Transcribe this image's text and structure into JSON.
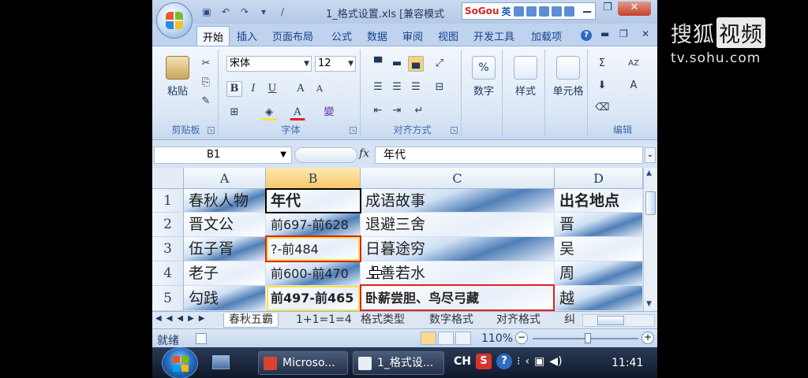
{
  "app": {
    "title": "1_格式设置.xls  [兼容模式",
    "sogou_brand": "SoGou",
    "sogou_mode": "英"
  },
  "ribbon_tabs": [
    "开始",
    "插入",
    "页面布局",
    "公式",
    "数据",
    "审阅",
    "视图",
    "开发工具",
    "加载项"
  ],
  "clipboard": {
    "paste_label": "粘贴",
    "group_label": "剪贴板"
  },
  "font": {
    "family": "宋体",
    "size": "12",
    "bold": "B",
    "italic": "I",
    "underline": "U",
    "grow": "A",
    "shrink": "A",
    "font_color": "A",
    "phonetic": "變",
    "group_label": "字体"
  },
  "alignment": {
    "group_label": "对齐方式"
  },
  "number": {
    "symbol": "%",
    "label": "数字"
  },
  "styles": {
    "label": "样式"
  },
  "cells": {
    "label": "单元格"
  },
  "editing": {
    "sum": "Σ",
    "sort": "AZ",
    "find": "A",
    "group_label": "编辑"
  },
  "formula_bar": {
    "name_box": "B1",
    "fx": "fx",
    "content": "年代"
  },
  "columns": [
    "A",
    "B",
    "C",
    "D"
  ],
  "rows": [
    {
      "num": "1",
      "a": "春秋人物",
      "b": "年代",
      "c": "成语故事",
      "d": "出名地点"
    },
    {
      "num": "2",
      "a": "晋文公",
      "b": "前697-前628",
      "c": "退避三舍",
      "d": "晋"
    },
    {
      "num": "3",
      "a": "伍子胥",
      "b": "?-前484",
      "c": "日暮途穷",
      "d": "吴"
    },
    {
      "num": "4",
      "a": "老子",
      "b": "前600-前470",
      "c": "上善若水",
      "d": "周"
    },
    {
      "num": "5",
      "a": "勾践",
      "b": "前497-前465",
      "c": "卧薪尝胆、鸟尽弓藏",
      "d": "越"
    }
  ],
  "sheet_tabs": [
    "春秋五霸",
    "1+1=1=4",
    "格式类型",
    "数字格式",
    "对齐格式",
    "纠"
  ],
  "status": {
    "ready": "就绪",
    "zoom": "110%"
  },
  "taskbar": {
    "apps": [
      "Microso...",
      "1_格式设..."
    ],
    "input_lang": "CH",
    "clock": "11:41"
  },
  "watermark": {
    "main": "搜狐",
    "boxed": "视频",
    "url": "tv.sohu.com"
  },
  "colors": {
    "accent": "#15428b",
    "selection": "#000000",
    "red_outline": "#e02020",
    "yellow_outline": "#f5e24a"
  }
}
